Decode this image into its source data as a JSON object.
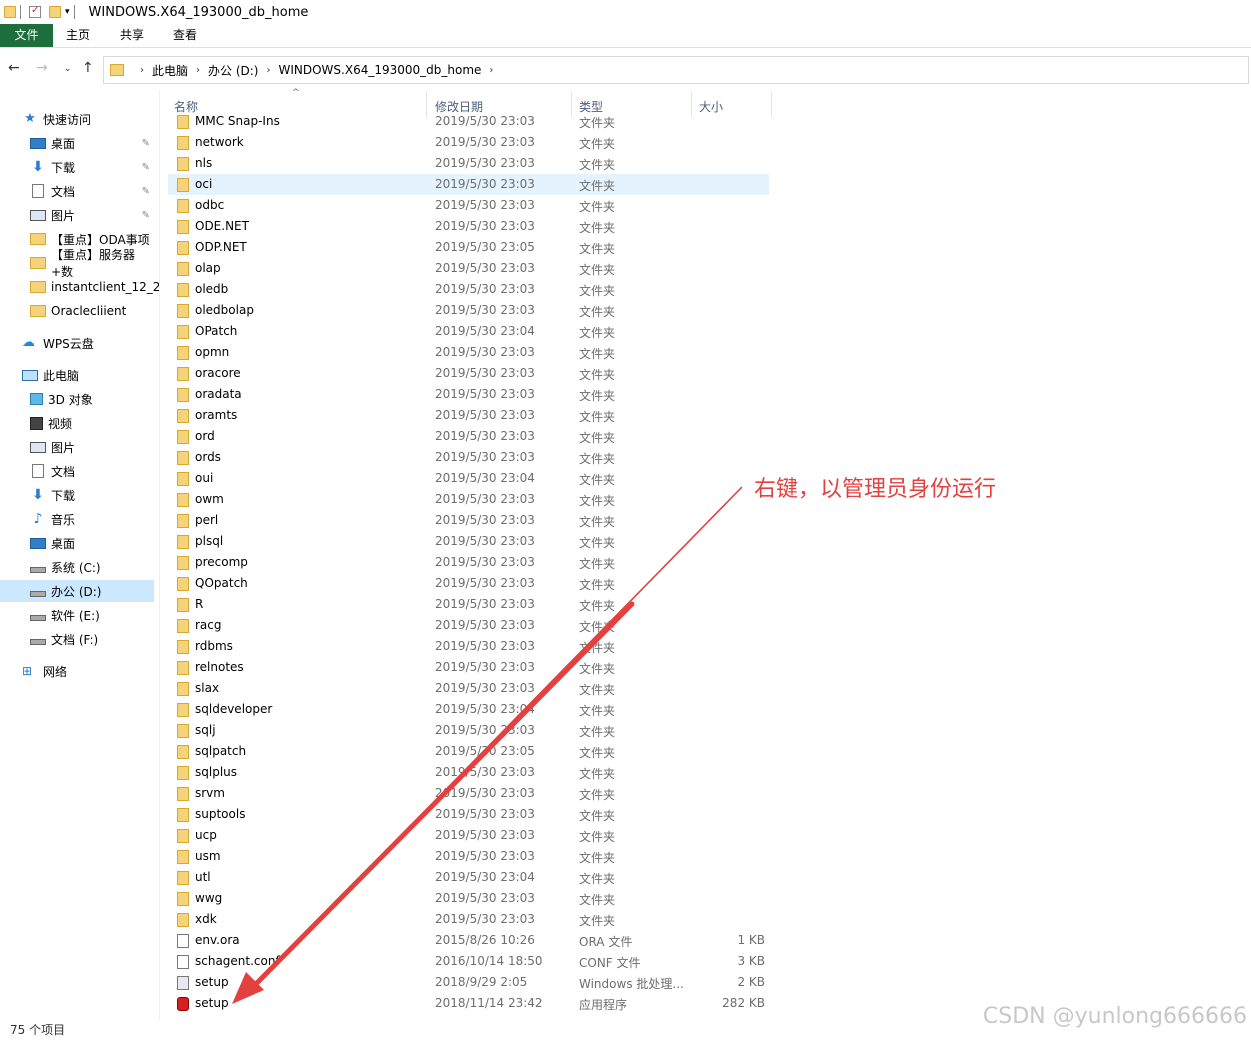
{
  "window": {
    "title": "WINDOWS.X64_193000_db_home"
  },
  "ribbon": {
    "tabs": [
      "文件",
      "主页",
      "共享",
      "查看"
    ]
  },
  "address": {
    "crumbs": [
      "此电脑",
      "办公 (D:)",
      "WINDOWS.X64_193000_db_home"
    ]
  },
  "sidebar": {
    "items": [
      {
        "label": "快速访问",
        "icon": "star-icon",
        "pinned": false
      },
      {
        "label": "桌面",
        "icon": "desktop-icon",
        "pinned": true
      },
      {
        "label": "下载",
        "icon": "download-icon",
        "pinned": true
      },
      {
        "label": "文档",
        "icon": "document-icon",
        "pinned": true
      },
      {
        "label": "图片",
        "icon": "pictures-icon",
        "pinned": true
      },
      {
        "label": "【重点】ODA事项",
        "icon": "folder-icon",
        "pinned": false
      },
      {
        "label": "【重点】服务器+数",
        "icon": "folder-icon",
        "pinned": false
      },
      {
        "label": "instantclient_12_2",
        "icon": "folder-icon",
        "pinned": false
      },
      {
        "label": "Oraclecliient",
        "icon": "folder-icon",
        "pinned": false
      },
      {
        "label": "WPS云盘",
        "icon": "cloud-icon",
        "pinned": false
      },
      {
        "label": "此电脑",
        "icon": "pc-icon",
        "pinned": false
      },
      {
        "label": "3D 对象",
        "icon": "cube-icon",
        "pinned": false
      },
      {
        "label": "视频",
        "icon": "video-icon",
        "pinned": false
      },
      {
        "label": "图片",
        "icon": "pictures-icon",
        "pinned": false
      },
      {
        "label": "文档",
        "icon": "document-icon",
        "pinned": false
      },
      {
        "label": "下载",
        "icon": "download-icon",
        "pinned": false
      },
      {
        "label": "音乐",
        "icon": "music-icon",
        "pinned": false
      },
      {
        "label": "桌面",
        "icon": "desktop-icon",
        "pinned": false
      },
      {
        "label": "系统 (C:)",
        "icon": "drive-icon",
        "pinned": false
      },
      {
        "label": "办公 (D:)",
        "icon": "drive-icon",
        "pinned": false,
        "selected": true
      },
      {
        "label": "软件 (E:)",
        "icon": "drive-icon",
        "pinned": false
      },
      {
        "label": "文档 (F:)",
        "icon": "drive-icon",
        "pinned": false
      },
      {
        "label": "网络",
        "icon": "network-icon",
        "pinned": false
      }
    ]
  },
  "columns": {
    "name": "名称",
    "date": "修改日期",
    "type": "类型",
    "size": "大小"
  },
  "files": [
    {
      "name": "MMC Snap-Ins",
      "date": "2019/5/30 23:03",
      "type": "文件夹",
      "size": "",
      "kind": "folder"
    },
    {
      "name": "network",
      "date": "2019/5/30 23:03",
      "type": "文件夹",
      "size": "",
      "kind": "folder"
    },
    {
      "name": "nls",
      "date": "2019/5/30 23:03",
      "type": "文件夹",
      "size": "",
      "kind": "folder"
    },
    {
      "name": "oci",
      "date": "2019/5/30 23:03",
      "type": "文件夹",
      "size": "",
      "kind": "folder",
      "hover": true
    },
    {
      "name": "odbc",
      "date": "2019/5/30 23:03",
      "type": "文件夹",
      "size": "",
      "kind": "folder"
    },
    {
      "name": "ODE.NET",
      "date": "2019/5/30 23:03",
      "type": "文件夹",
      "size": "",
      "kind": "folder"
    },
    {
      "name": "ODP.NET",
      "date": "2019/5/30 23:05",
      "type": "文件夹",
      "size": "",
      "kind": "folder"
    },
    {
      "name": "olap",
      "date": "2019/5/30 23:03",
      "type": "文件夹",
      "size": "",
      "kind": "folder"
    },
    {
      "name": "oledb",
      "date": "2019/5/30 23:03",
      "type": "文件夹",
      "size": "",
      "kind": "folder"
    },
    {
      "name": "oledbolap",
      "date": "2019/5/30 23:03",
      "type": "文件夹",
      "size": "",
      "kind": "folder"
    },
    {
      "name": "OPatch",
      "date": "2019/5/30 23:04",
      "type": "文件夹",
      "size": "",
      "kind": "folder"
    },
    {
      "name": "opmn",
      "date": "2019/5/30 23:03",
      "type": "文件夹",
      "size": "",
      "kind": "folder"
    },
    {
      "name": "oracore",
      "date": "2019/5/30 23:03",
      "type": "文件夹",
      "size": "",
      "kind": "folder"
    },
    {
      "name": "oradata",
      "date": "2019/5/30 23:03",
      "type": "文件夹",
      "size": "",
      "kind": "folder"
    },
    {
      "name": "oramts",
      "date": "2019/5/30 23:03",
      "type": "文件夹",
      "size": "",
      "kind": "folder"
    },
    {
      "name": "ord",
      "date": "2019/5/30 23:03",
      "type": "文件夹",
      "size": "",
      "kind": "folder"
    },
    {
      "name": "ords",
      "date": "2019/5/30 23:03",
      "type": "文件夹",
      "size": "",
      "kind": "folder"
    },
    {
      "name": "oui",
      "date": "2019/5/30 23:04",
      "type": "文件夹",
      "size": "",
      "kind": "folder"
    },
    {
      "name": "owm",
      "date": "2019/5/30 23:03",
      "type": "文件夹",
      "size": "",
      "kind": "folder"
    },
    {
      "name": "perl",
      "date": "2019/5/30 23:03",
      "type": "文件夹",
      "size": "",
      "kind": "folder"
    },
    {
      "name": "plsql",
      "date": "2019/5/30 23:03",
      "type": "文件夹",
      "size": "",
      "kind": "folder"
    },
    {
      "name": "precomp",
      "date": "2019/5/30 23:03",
      "type": "文件夹",
      "size": "",
      "kind": "folder"
    },
    {
      "name": "QOpatch",
      "date": "2019/5/30 23:03",
      "type": "文件夹",
      "size": "",
      "kind": "folder"
    },
    {
      "name": "R",
      "date": "2019/5/30 23:03",
      "type": "文件夹",
      "size": "",
      "kind": "folder"
    },
    {
      "name": "racg",
      "date": "2019/5/30 23:03",
      "type": "文件夹",
      "size": "",
      "kind": "folder"
    },
    {
      "name": "rdbms",
      "date": "2019/5/30 23:03",
      "type": "文件夹",
      "size": "",
      "kind": "folder"
    },
    {
      "name": "relnotes",
      "date": "2019/5/30 23:03",
      "type": "文件夹",
      "size": "",
      "kind": "folder"
    },
    {
      "name": "slax",
      "date": "2019/5/30 23:03",
      "type": "文件夹",
      "size": "",
      "kind": "folder"
    },
    {
      "name": "sqldeveloper",
      "date": "2019/5/30 23:04",
      "type": "文件夹",
      "size": "",
      "kind": "folder"
    },
    {
      "name": "sqlj",
      "date": "2019/5/30 23:03",
      "type": "文件夹",
      "size": "",
      "kind": "folder"
    },
    {
      "name": "sqlpatch",
      "date": "2019/5/30 23:05",
      "type": "文件夹",
      "size": "",
      "kind": "folder"
    },
    {
      "name": "sqlplus",
      "date": "2019/5/30 23:03",
      "type": "文件夹",
      "size": "",
      "kind": "folder"
    },
    {
      "name": "srvm",
      "date": "2019/5/30 23:03",
      "type": "文件夹",
      "size": "",
      "kind": "folder"
    },
    {
      "name": "suptools",
      "date": "2019/5/30 23:03",
      "type": "文件夹",
      "size": "",
      "kind": "folder"
    },
    {
      "name": "ucp",
      "date": "2019/5/30 23:03",
      "type": "文件夹",
      "size": "",
      "kind": "folder"
    },
    {
      "name": "usm",
      "date": "2019/5/30 23:03",
      "type": "文件夹",
      "size": "",
      "kind": "folder"
    },
    {
      "name": "utl",
      "date": "2019/5/30 23:04",
      "type": "文件夹",
      "size": "",
      "kind": "folder"
    },
    {
      "name": "wwg",
      "date": "2019/5/30 23:03",
      "type": "文件夹",
      "size": "",
      "kind": "folder"
    },
    {
      "name": "xdk",
      "date": "2019/5/30 23:03",
      "type": "文件夹",
      "size": "",
      "kind": "folder"
    },
    {
      "name": "env.ora",
      "date": "2015/8/26 10:26",
      "type": "ORA 文件",
      "size": "1 KB",
      "kind": "file"
    },
    {
      "name": "schagent.conf",
      "date": "2016/10/14 18:50",
      "type": "CONF 文件",
      "size": "3 KB",
      "kind": "file"
    },
    {
      "name": "setup",
      "date": "2018/9/29 2:05",
      "type": "Windows 批处理...",
      "size": "2 KB",
      "kind": "batch"
    },
    {
      "name": "setup",
      "date": "2018/11/14 23:42",
      "type": "应用程序",
      "size": "282 KB",
      "kind": "setup"
    }
  ],
  "status": {
    "count": "75 个项目"
  },
  "annotation": {
    "text": "右键，以管理员身份运行",
    "color": "#e3403f"
  },
  "watermark": "CSDN @yunlong666666",
  "colors": {
    "file_tab": "#1c6e3c",
    "selection": "#cce8ff",
    "hover": "#e5f3ff",
    "folder": "#f5d37b"
  }
}
